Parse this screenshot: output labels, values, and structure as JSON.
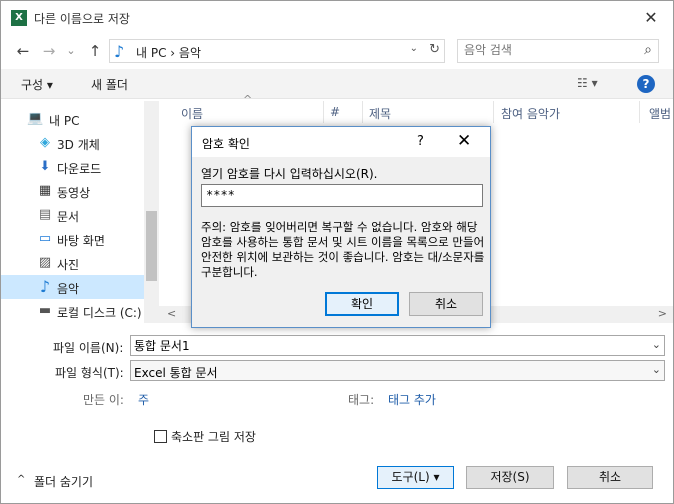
{
  "window": {
    "app_icon": "X",
    "title": "다른 이름으로 저장",
    "close": "✕"
  },
  "nav": {
    "back": "←",
    "forward": "→",
    "recent": "⌄",
    "up": "↑",
    "address": "내 PC  ›  음악",
    "address_dd": "⌄",
    "refresh": "↻",
    "search_placeholder": "음악 검색"
  },
  "toolbar": {
    "organize": "구성 ▾",
    "new_folder": "새 폴더",
    "view": "☷ ▾",
    "help": "?"
  },
  "sidebar": {
    "items": [
      {
        "label": "내 PC",
        "icon": "💻"
      },
      {
        "label": "3D 개체",
        "icon": "◈"
      },
      {
        "label": "다운로드",
        "icon": "⬇"
      },
      {
        "label": "동영상",
        "icon": "▦"
      },
      {
        "label": "문서",
        "icon": "▤"
      },
      {
        "label": "바탕 화면",
        "icon": "▭"
      },
      {
        "label": "사진",
        "icon": "▨"
      },
      {
        "label": "음악",
        "icon": "♪"
      },
      {
        "label": "로컬 디스크 (C:)",
        "icon": "▬"
      }
    ]
  },
  "filelist": {
    "columns": [
      "이름",
      "#",
      "제목",
      "참여 음악가",
      "앨범"
    ],
    "sort_arrow": "^",
    "scroll_left": "<",
    "scroll_right": ">"
  },
  "form": {
    "filename_label": "파일 이름(N):",
    "filename_value": "통합 문서1",
    "filetype_label": "파일 형식(T):",
    "filetype_value": "Excel 통합 문서",
    "dd": "⌄",
    "author_label": "만든 이:",
    "author_value": "주",
    "tags_label": "태그:",
    "tags_value": "태그 추가",
    "thumbnail_label": "축소판 그림 저장"
  },
  "footer": {
    "hide_folders": "폴더 숨기기",
    "hide_arrow": "^",
    "tools": "도구(L)   ▾",
    "save": "저장(S)",
    "cancel": "취소"
  },
  "dialog": {
    "title": "암호 확인",
    "help": "?",
    "close": "✕",
    "prompt": "열기 암호를 다시 입력하십시오(R).",
    "password": "****",
    "note": "주의: 암호를 잊어버리면 복구할 수 없습니다. 암호와 해당 암호를 사용하는 통합 문서 및 시트 이름을 목록으로 만들어 안전한 위치에 보관하는 것이 좋습니다. 암호는 대/소문자를 구분합니다.",
    "ok": "확인",
    "cancel": "취소"
  }
}
